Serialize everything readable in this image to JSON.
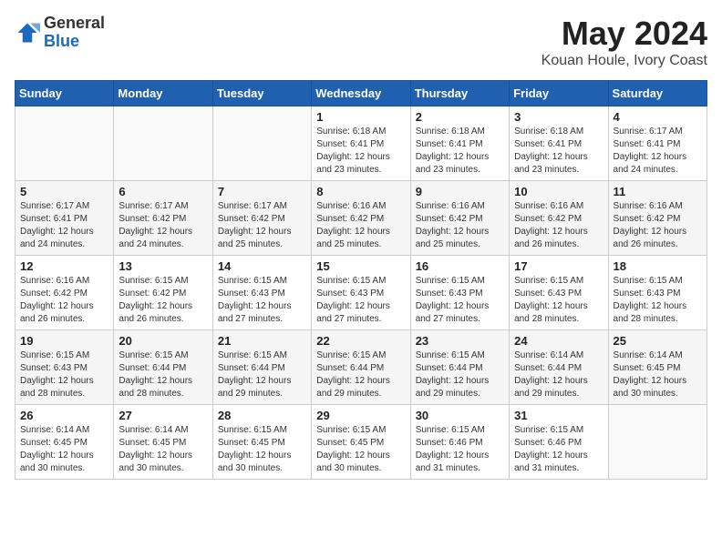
{
  "header": {
    "logo_general": "General",
    "logo_blue": "Blue",
    "title": "May 2024",
    "subtitle": "Kouan Houle, Ivory Coast"
  },
  "days_of_week": [
    "Sunday",
    "Monday",
    "Tuesday",
    "Wednesday",
    "Thursday",
    "Friday",
    "Saturday"
  ],
  "weeks": [
    [
      {
        "day": "",
        "sunrise": "",
        "sunset": "",
        "daylight": ""
      },
      {
        "day": "",
        "sunrise": "",
        "sunset": "",
        "daylight": ""
      },
      {
        "day": "",
        "sunrise": "",
        "sunset": "",
        "daylight": ""
      },
      {
        "day": "1",
        "sunrise": "Sunrise: 6:18 AM",
        "sunset": "Sunset: 6:41 PM",
        "daylight": "Daylight: 12 hours and 23 minutes."
      },
      {
        "day": "2",
        "sunrise": "Sunrise: 6:18 AM",
        "sunset": "Sunset: 6:41 PM",
        "daylight": "Daylight: 12 hours and 23 minutes."
      },
      {
        "day": "3",
        "sunrise": "Sunrise: 6:18 AM",
        "sunset": "Sunset: 6:41 PM",
        "daylight": "Daylight: 12 hours and 23 minutes."
      },
      {
        "day": "4",
        "sunrise": "Sunrise: 6:17 AM",
        "sunset": "Sunset: 6:41 PM",
        "daylight": "Daylight: 12 hours and 24 minutes."
      }
    ],
    [
      {
        "day": "5",
        "sunrise": "Sunrise: 6:17 AM",
        "sunset": "Sunset: 6:41 PM",
        "daylight": "Daylight: 12 hours and 24 minutes."
      },
      {
        "day": "6",
        "sunrise": "Sunrise: 6:17 AM",
        "sunset": "Sunset: 6:42 PM",
        "daylight": "Daylight: 12 hours and 24 minutes."
      },
      {
        "day": "7",
        "sunrise": "Sunrise: 6:17 AM",
        "sunset": "Sunset: 6:42 PM",
        "daylight": "Daylight: 12 hours and 25 minutes."
      },
      {
        "day": "8",
        "sunrise": "Sunrise: 6:16 AM",
        "sunset": "Sunset: 6:42 PM",
        "daylight": "Daylight: 12 hours and 25 minutes."
      },
      {
        "day": "9",
        "sunrise": "Sunrise: 6:16 AM",
        "sunset": "Sunset: 6:42 PM",
        "daylight": "Daylight: 12 hours and 25 minutes."
      },
      {
        "day": "10",
        "sunrise": "Sunrise: 6:16 AM",
        "sunset": "Sunset: 6:42 PM",
        "daylight": "Daylight: 12 hours and 26 minutes."
      },
      {
        "day": "11",
        "sunrise": "Sunrise: 6:16 AM",
        "sunset": "Sunset: 6:42 PM",
        "daylight": "Daylight: 12 hours and 26 minutes."
      }
    ],
    [
      {
        "day": "12",
        "sunrise": "Sunrise: 6:16 AM",
        "sunset": "Sunset: 6:42 PM",
        "daylight": "Daylight: 12 hours and 26 minutes."
      },
      {
        "day": "13",
        "sunrise": "Sunrise: 6:15 AM",
        "sunset": "Sunset: 6:42 PM",
        "daylight": "Daylight: 12 hours and 26 minutes."
      },
      {
        "day": "14",
        "sunrise": "Sunrise: 6:15 AM",
        "sunset": "Sunset: 6:43 PM",
        "daylight": "Daylight: 12 hours and 27 minutes."
      },
      {
        "day": "15",
        "sunrise": "Sunrise: 6:15 AM",
        "sunset": "Sunset: 6:43 PM",
        "daylight": "Daylight: 12 hours and 27 minutes."
      },
      {
        "day": "16",
        "sunrise": "Sunrise: 6:15 AM",
        "sunset": "Sunset: 6:43 PM",
        "daylight": "Daylight: 12 hours and 27 minutes."
      },
      {
        "day": "17",
        "sunrise": "Sunrise: 6:15 AM",
        "sunset": "Sunset: 6:43 PM",
        "daylight": "Daylight: 12 hours and 28 minutes."
      },
      {
        "day": "18",
        "sunrise": "Sunrise: 6:15 AM",
        "sunset": "Sunset: 6:43 PM",
        "daylight": "Daylight: 12 hours and 28 minutes."
      }
    ],
    [
      {
        "day": "19",
        "sunrise": "Sunrise: 6:15 AM",
        "sunset": "Sunset: 6:43 PM",
        "daylight": "Daylight: 12 hours and 28 minutes."
      },
      {
        "day": "20",
        "sunrise": "Sunrise: 6:15 AM",
        "sunset": "Sunset: 6:44 PM",
        "daylight": "Daylight: 12 hours and 28 minutes."
      },
      {
        "day": "21",
        "sunrise": "Sunrise: 6:15 AM",
        "sunset": "Sunset: 6:44 PM",
        "daylight": "Daylight: 12 hours and 29 minutes."
      },
      {
        "day": "22",
        "sunrise": "Sunrise: 6:15 AM",
        "sunset": "Sunset: 6:44 PM",
        "daylight": "Daylight: 12 hours and 29 minutes."
      },
      {
        "day": "23",
        "sunrise": "Sunrise: 6:15 AM",
        "sunset": "Sunset: 6:44 PM",
        "daylight": "Daylight: 12 hours and 29 minutes."
      },
      {
        "day": "24",
        "sunrise": "Sunrise: 6:14 AM",
        "sunset": "Sunset: 6:44 PM",
        "daylight": "Daylight: 12 hours and 29 minutes."
      },
      {
        "day": "25",
        "sunrise": "Sunrise: 6:14 AM",
        "sunset": "Sunset: 6:45 PM",
        "daylight": "Daylight: 12 hours and 30 minutes."
      }
    ],
    [
      {
        "day": "26",
        "sunrise": "Sunrise: 6:14 AM",
        "sunset": "Sunset: 6:45 PM",
        "daylight": "Daylight: 12 hours and 30 minutes."
      },
      {
        "day": "27",
        "sunrise": "Sunrise: 6:14 AM",
        "sunset": "Sunset: 6:45 PM",
        "daylight": "Daylight: 12 hours and 30 minutes."
      },
      {
        "day": "28",
        "sunrise": "Sunrise: 6:15 AM",
        "sunset": "Sunset: 6:45 PM",
        "daylight": "Daylight: 12 hours and 30 minutes."
      },
      {
        "day": "29",
        "sunrise": "Sunrise: 6:15 AM",
        "sunset": "Sunset: 6:45 PM",
        "daylight": "Daylight: 12 hours and 30 minutes."
      },
      {
        "day": "30",
        "sunrise": "Sunrise: 6:15 AM",
        "sunset": "Sunset: 6:46 PM",
        "daylight": "Daylight: 12 hours and 31 minutes."
      },
      {
        "day": "31",
        "sunrise": "Sunrise: 6:15 AM",
        "sunset": "Sunset: 6:46 PM",
        "daylight": "Daylight: 12 hours and 31 minutes."
      },
      {
        "day": "",
        "sunrise": "",
        "sunset": "",
        "daylight": ""
      }
    ]
  ]
}
